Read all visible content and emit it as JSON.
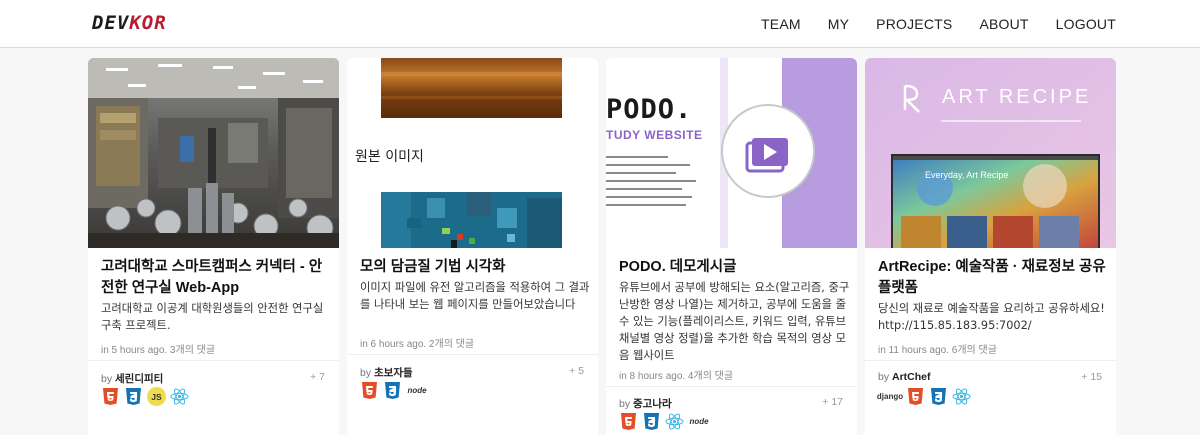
{
  "brand": {
    "part1": "DEV",
    "part2": "KOR"
  },
  "nav": [
    "TEAM",
    "MY",
    "PROJECTS",
    "ABOUT",
    "LOGOUT"
  ],
  "cards": [
    {
      "title": "고려대학교 스마트캠퍼스 커넥터 - 안전한 연구실 Web-App",
      "desc": "고려대학교 이공계 대학원생들의 안전한 연구실 구축 프로젝트.",
      "meta": "in 5 hours ago. 3개의 댓글",
      "by": "by",
      "author": "세린디피티",
      "count": "+ 7",
      "tech": [
        "html5-icon",
        "css3-icon",
        "js-icon",
        "react-icon"
      ]
    },
    {
      "title": "모의 담금질 기법 시각화",
      "desc": "이미지 파일에 유전 알고리즘을 적용하여 그 결과를 나타내 보는 웹 페이지를 만들어보았습니다",
      "meta": "in 6 hours ago. 2개의 댓글",
      "by": "by",
      "author": "초보자들",
      "count": "+ 5",
      "image_text": "원본 이미지",
      "tech": [
        "html5-icon",
        "css3-icon",
        "node-icon"
      ]
    },
    {
      "title": "PODO. 데모게시글",
      "desc": "유튜브에서 공부에 방해되는 요소(알고리즘, 중구난방한 영상 나열)는 제거하고, 공부에 도움을 줄 수 있는 기능(플레이리스트, 키워드 입력, 유튜브채널별 영상 정렬)을 추가한 학습 목적의 영상 모음 웹사이트",
      "meta": "in 8 hours ago. 4개의 댓글",
      "by": "by",
      "author": "중고나라",
      "count": "+ 17",
      "image_title": "PODO.",
      "image_subtitle": "TUDY WEBSITE",
      "tech": [
        "html5-icon",
        "css3-icon",
        "react-icon",
        "node-icon"
      ]
    },
    {
      "title": "ArtRecipe: 예술작품 · 재료정보 공유 플랫폼",
      "desc": "당신의 재료로 예술작품을 요리하고 공유하세요! http://115.85.183.95:7002/",
      "meta": "in 11 hours ago. 6개의 댓글",
      "by": "by",
      "author": "ArtChef",
      "count": "+ 15",
      "image_title": "ART RECIPE",
      "image_tagline": "Everyday, Art Recipe",
      "tech": [
        "django-icon",
        "html5-icon",
        "css3-icon",
        "react-icon"
      ]
    }
  ],
  "tech_labels": {
    "node": "node",
    "django": "django",
    "js": "JS"
  },
  "colors": {
    "html5": "#e44d26",
    "css3": "#1572b6",
    "js": "#f0db4f",
    "react": "#61dafb",
    "node": "#539e43",
    "brand_accent": "#b81c2e",
    "podo_purple": "#b79ddf"
  }
}
